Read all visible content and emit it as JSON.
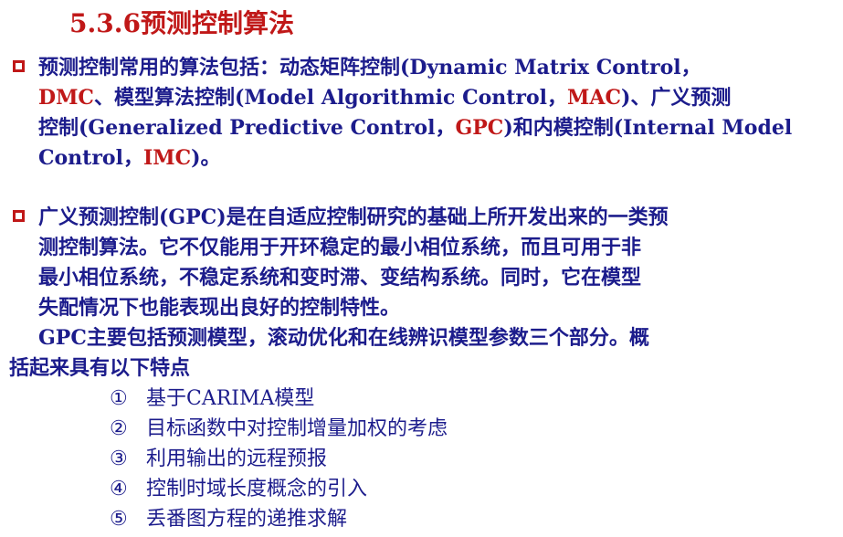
{
  "title": "5.3.6预测控制算法",
  "section1": {
    "lines": [
      [
        "预测控制常用的算法包括：动态矩阵控制(Dynamic  Matrix  Control，"
      ],
      [
        "DMC",
        "、模型算法控制(Model  Algorithmic  Control，",
        "MAC",
        ")、广义预测"
      ],
      [
        "控制(Generalized Predictive Control，",
        "GPC",
        ")和内模控制(Internal Model"
      ],
      [
        "Control，",
        "IMC",
        ")。"
      ]
    ]
  },
  "section2": {
    "lines": [
      "广义预测控制(GPC)是在自适应控制研究的基础上所开发出来的一类预",
      "测控制算法。它不仅能用于开环稳定的最小相位系统，而且可用于非",
      "最小相位系统，不稳定系统和变时滞、变结构系统。同时，它在模型",
      "失配情况下也能表现出良好的控制特性。"
    ],
    "summary_lines": [
      "GPC主要包括预测模型，滚动优化和在线辨识模型参数三个部分。概",
      "括起来具有以下特点"
    ]
  },
  "features": [
    {
      "num": "①",
      "text": "基于CARIMA模型"
    },
    {
      "num": "②",
      "text": "目标函数中对控制增量加权的考虑"
    },
    {
      "num": "③",
      "text": "利用输出的远程预报"
    },
    {
      "num": "④",
      "text": "控制时域长度概念的引入"
    },
    {
      "num": "⑤",
      "text": "丢番图方程的递推求解"
    }
  ],
  "colors": {
    "accent": "#c01818",
    "text": "#1c1c8c"
  }
}
